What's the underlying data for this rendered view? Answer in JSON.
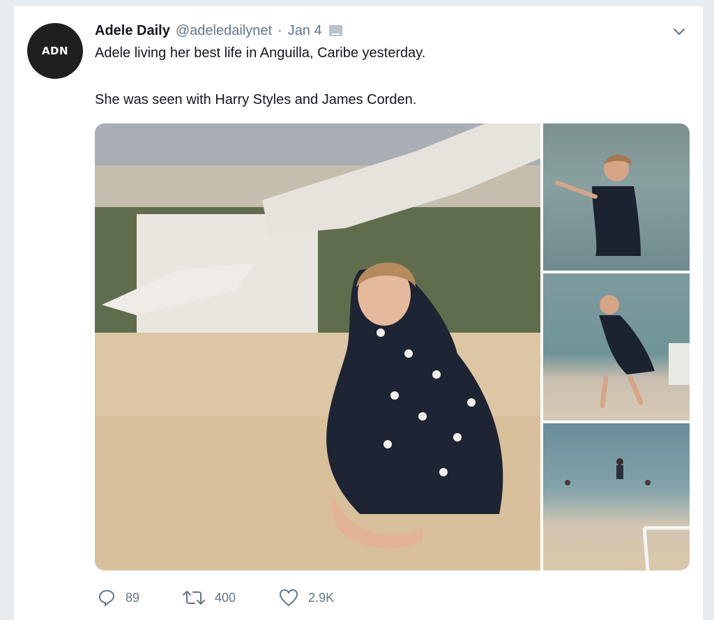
{
  "tweet": {
    "avatar_text": "ADN",
    "name": "Adele Daily",
    "handle": "@adeledailynet",
    "separator": "·",
    "date": "Jan 4",
    "text_line1": "Adele living her best life in Anguilla, Caribe yesterday.",
    "text_line2": "She was seen with Harry Styles and James Corden."
  },
  "icons": {
    "caret": "chevron-down-icon",
    "reply": "reply-icon",
    "retweet": "retweet-icon",
    "like": "heart-icon"
  },
  "actions": {
    "reply_count": "89",
    "retweet_count": "400",
    "like_count": "2.9K"
  },
  "colors": {
    "background": "#e6ecf0",
    "secondary_text": "#657786",
    "primary_text": "#14171a"
  }
}
